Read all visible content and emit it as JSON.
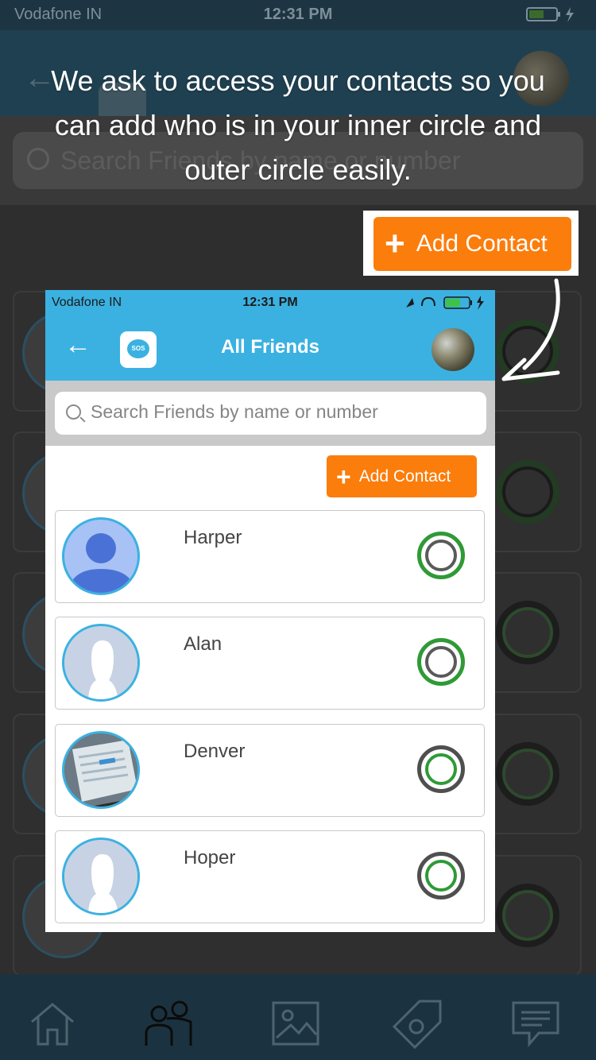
{
  "status_bar": {
    "carrier": "Vodafone IN",
    "time": "12:31 PM"
  },
  "background_app": {
    "search_placeholder": "Search Friends by name or number"
  },
  "overlay": {
    "instruction_text": "We ask to access your contacts so you can add who is in your inner circle and outer circle easily.",
    "highlighted_button_label": "Add Contact"
  },
  "inset_screen": {
    "status_bar": {
      "carrier": "Vodafone IN",
      "time": "12:31 PM"
    },
    "header": {
      "title": "All Friends",
      "logo_text": "SOS"
    },
    "search": {
      "placeholder": "Search Friends by name or number"
    },
    "add_contact_label": "Add Contact",
    "friends": [
      {
        "name": "Harper",
        "avatar": "google-default-avatar",
        "circle": "inner"
      },
      {
        "name": "Alan",
        "avatar": "silhouette-avatar",
        "circle": "inner"
      },
      {
        "name": "Denver",
        "avatar": "photo-avatar",
        "circle": "outer"
      },
      {
        "name": "Hoper",
        "avatar": "silhouette-avatar",
        "circle": "outer"
      }
    ]
  },
  "colors": {
    "accent_blue": "#3bb1e1",
    "accent_orange": "#fb7d0c",
    "inner_ring_green": "#2f9a36",
    "overlay_dim": "#2e2e2e"
  },
  "tabbar": {
    "icons": [
      "home-icon",
      "friends-icon",
      "gallery-icon",
      "tag-icon",
      "chat-icon"
    ]
  }
}
